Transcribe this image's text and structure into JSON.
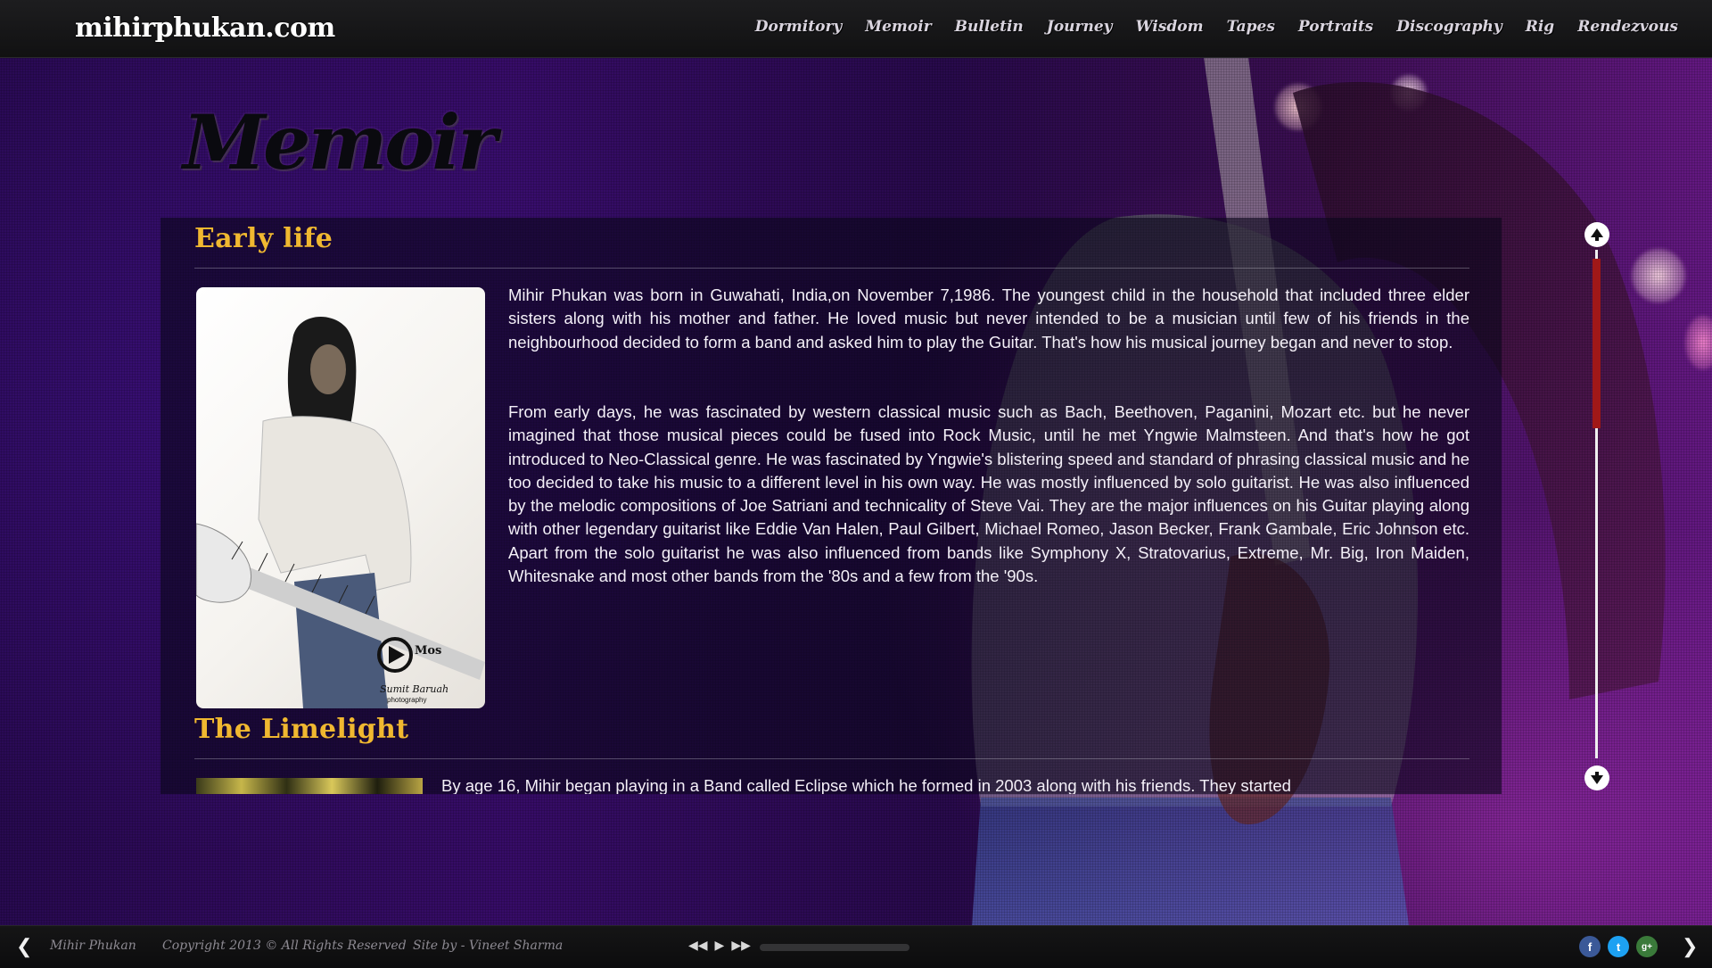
{
  "site": {
    "logo": "mihirphukan.com"
  },
  "nav": [
    "Dormitory",
    "Memoir",
    "Bulletin",
    "Journey",
    "Wisdom",
    "Tapes",
    "Portraits",
    "Discography",
    "Rig",
    "Rendezvous"
  ],
  "page": {
    "title": "Memoir"
  },
  "sections": [
    {
      "title": "Early life",
      "paragraphs": [
        "Mihir Phukan was born in Guwahati, India,on November 7,1986. The youngest child in the household that included three elder sisters along with his mother and father. He loved music but never intended to be a musician until few of his friends in the neighbourhood decided to form a band and asked him to play the Guitar. That's how his musical journey began and never to stop.",
        "From early days, he was fascinated by western classical music such as Bach, Beethoven, Paganini, Mozart etc. but he never imagined that those musical pieces could be fused into Rock Music, until he met Yngwie Malmsteen. And that's how he got introduced to Neo-Classical genre. He was fascinated by Yngwie's blistering speed and standard of phrasing classical music and he too decided to take his music to a different level in his own way. He was mostly influenced by solo guitarist. He was also influenced by the melodic compositions of Joe Satriani and technicality of Steve Vai. They are the major influences on his Guitar playing along with other legendary guitarist like Eddie Van Halen, Paul Gilbert, Michael Romeo, Jason Becker, Frank Gambale, Eric Johnson etc. Apart from the solo guitarist he was also influenced from bands like Symphony X, Stratovarius, Extreme, Mr. Big, Iron Maiden, Whitesnake and most other bands from the '80s and a few from the '90s."
      ],
      "photo_caption": {
        "brand": "Mos",
        "credit": "Sumit Baruah",
        "sub": "photography"
      }
    },
    {
      "title": "The Limelight",
      "paragraphs": [
        "By age 16, Mihir began playing in a Band called Eclipse which he formed in 2003 along with his friends. They started"
      ]
    }
  ],
  "footer": {
    "name": "Mihir Phukan",
    "copyright": "Copyright 2013 © All Rights Reserved",
    "credit": "Site by - Vineet Sharma",
    "player_icons": [
      "rewind-icon",
      "play-icon",
      "fast-forward-icon"
    ],
    "social_icons": [
      "facebook-icon",
      "twitter-icon",
      "google-plus-icon"
    ],
    "social_glyphs": [
      "f",
      "t",
      "g+"
    ]
  },
  "colors": {
    "accent": "#f0b830",
    "scroll_thumb": "#a01818",
    "panel": "#0c061c"
  }
}
